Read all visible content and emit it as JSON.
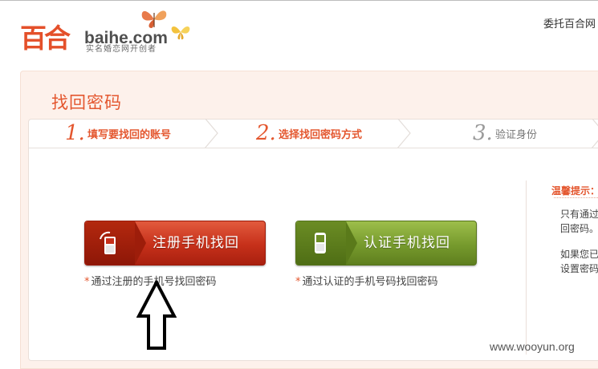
{
  "header": {
    "logo_cn": "百合",
    "logo_en": "baihe.com",
    "logo_slogan": "实名婚恋网开创者",
    "top_right_link": "委托百合网"
  },
  "page": {
    "title": "找回密码"
  },
  "steps": [
    {
      "num": "1.",
      "label": "填写要找回的账号",
      "active": true
    },
    {
      "num": "2.",
      "label": "选择找回密码方式",
      "active": true
    },
    {
      "num": "3.",
      "label": "验证身份",
      "active": false
    }
  ],
  "options": {
    "registered_phone": {
      "label": "注册手机找回",
      "hint_star": "*",
      "hint": "通过注册的手机号找回密码"
    },
    "verified_phone": {
      "label": "认证手机找回",
      "hint_star": "*",
      "hint": "通过认证的手机号码找回密码"
    }
  },
  "tips": {
    "title": "温馨提示：",
    "lines": [
      "只有通过",
      "回密码。",
      "如果您已",
      "设置密码"
    ]
  },
  "watermark": "www.wooyun.org",
  "colors": {
    "brand_orange": "#e4572f",
    "panel_bg": "#fdf1eb",
    "red_button": "#c6301a",
    "green_button": "#769a2d"
  },
  "icons": {
    "butterfly": "butterfly-icon",
    "phone": "mobile-phone-icon",
    "annotation_arrow": "up-arrow-icon"
  }
}
